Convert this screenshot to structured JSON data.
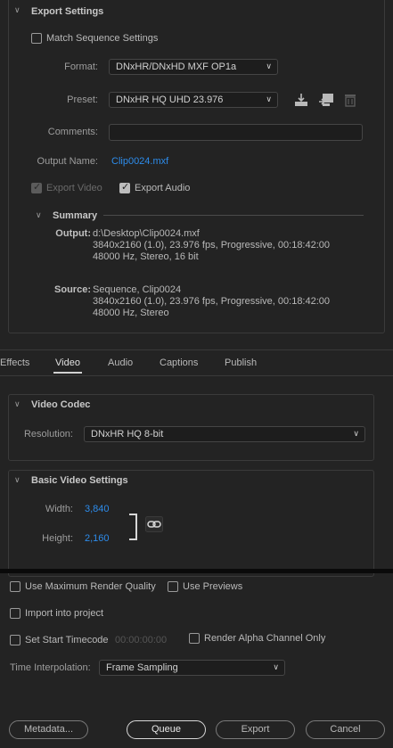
{
  "export_settings": {
    "title": "Export Settings",
    "match_sequence_label": "Match Sequence Settings",
    "format_label": "Format:",
    "format_value": "DNxHR/DNxHD MXF OP1a",
    "preset_label": "Preset:",
    "preset_value": "DNxHR HQ UHD 23.976",
    "comments_label": "Comments:",
    "comments_value": "",
    "output_name_label": "Output Name:",
    "output_name_value": "Clip0024.mxf",
    "export_video_label": "Export Video",
    "export_audio_label": "Export Audio"
  },
  "summary": {
    "title": "Summary",
    "output_key": "Output:",
    "output_lines": [
      "d:\\Desktop\\Clip0024.mxf",
      "3840x2160 (1.0), 23.976 fps, Progressive, 00:18:42:00",
      "48000 Hz, Stereo, 16 bit"
    ],
    "source_key": "Source:",
    "source_lines": [
      "Sequence, Clip0024",
      "3840x2160 (1.0), 23.976 fps, Progressive, 00:18:42:00",
      "48000 Hz, Stereo"
    ]
  },
  "tabs": [
    "Effects",
    "Video",
    "Audio",
    "Captions",
    "Publish"
  ],
  "video_codec": {
    "title": "Video Codec",
    "resolution_label": "Resolution:",
    "resolution_value": "DNxHR HQ 8-bit"
  },
  "basic_video": {
    "title": "Basic Video Settings",
    "width_label": "Width:",
    "width_value": "3,840",
    "height_label": "Height:",
    "height_value": "2,160"
  },
  "bottom": {
    "max_render_label": "Use Maximum Render Quality",
    "use_previews_label": "Use Previews",
    "import_label": "Import into project",
    "start_timecode_label": "Set Start Timecode",
    "start_timecode_value": "00:00:00:00",
    "alpha_label": "Render Alpha Channel Only",
    "time_interp_label": "Time Interpolation:",
    "time_interp_value": "Frame Sampling"
  },
  "buttons": {
    "metadata": "Metadata...",
    "queue": "Queue",
    "export": "Export",
    "cancel": "Cancel"
  }
}
